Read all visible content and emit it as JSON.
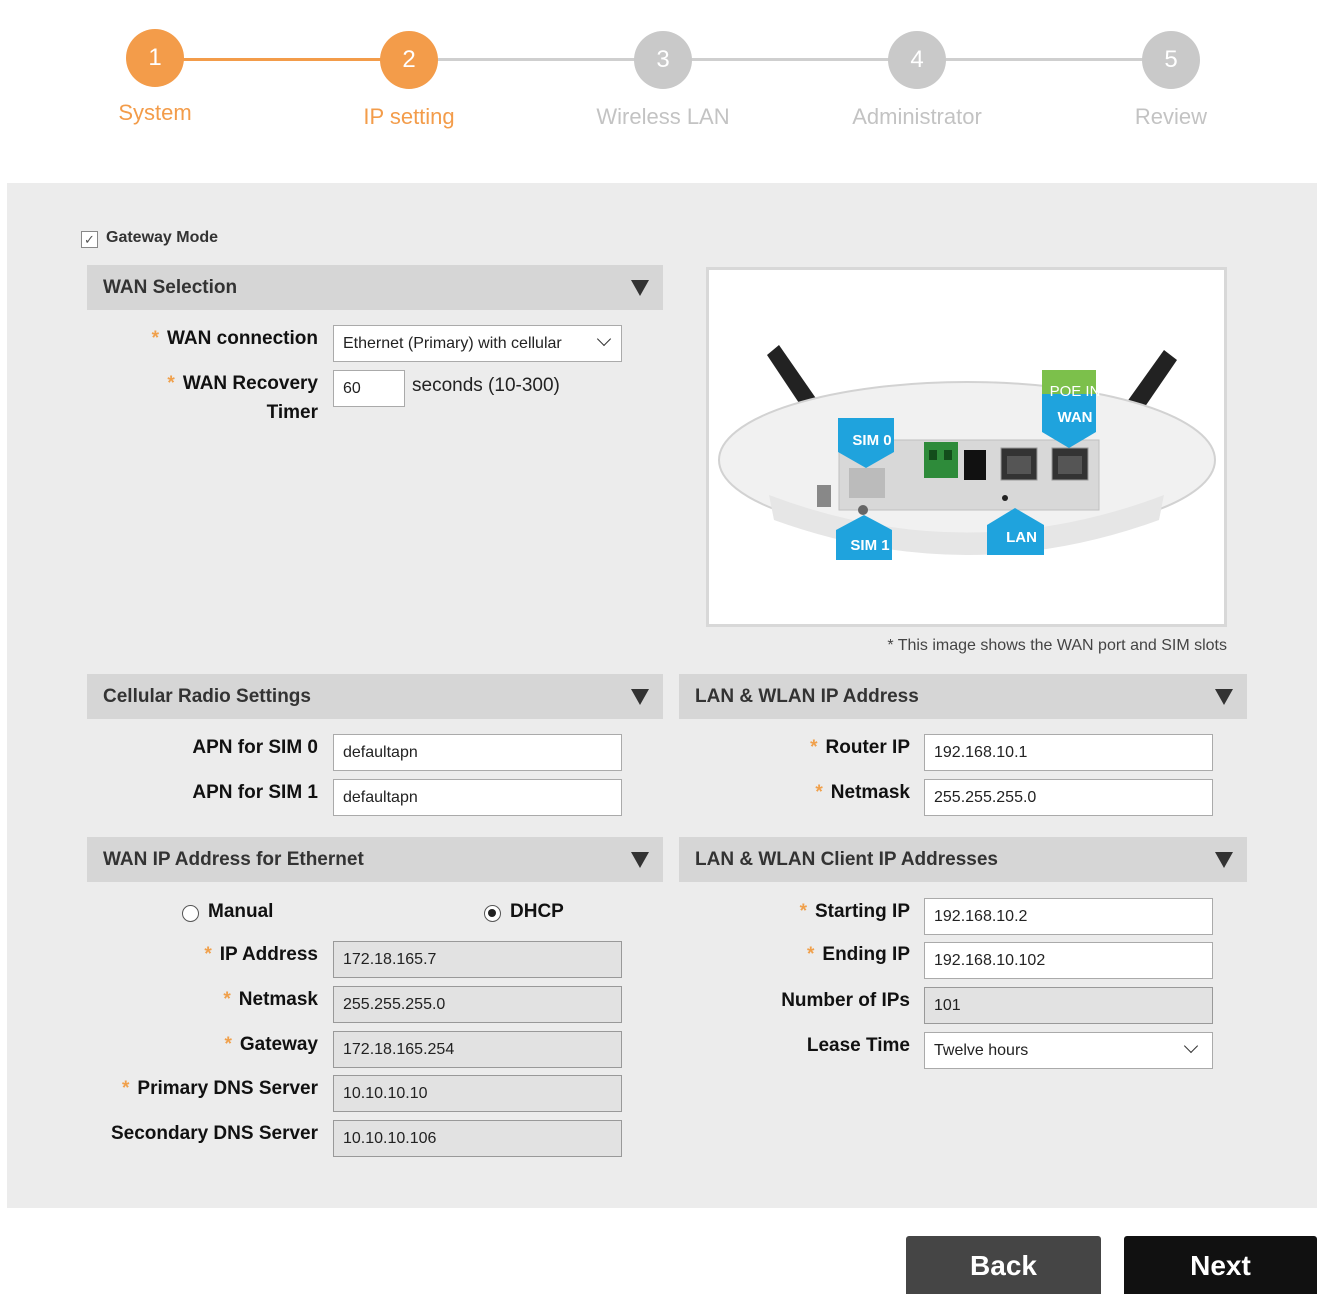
{
  "colors": {
    "active": "#f39c4a",
    "inactive_circle": "#c9c9c9",
    "inactive_text": "#c3c3c3",
    "active_line": "#f39c4a",
    "inactive_line": "#cfcfcf",
    "back_button": "#454545",
    "next_button": "#111111"
  },
  "stepper": {
    "steps": [
      {
        "number": "1",
        "label": "System",
        "state": "done"
      },
      {
        "number": "2",
        "label": "IP setting",
        "state": "current"
      },
      {
        "number": "3",
        "label": "Wireless LAN",
        "state": "todo"
      },
      {
        "number": "4",
        "label": "Administrator",
        "state": "todo"
      },
      {
        "number": "5",
        "label": "Review",
        "state": "todo"
      }
    ]
  },
  "gateway_mode": {
    "label": "Gateway Mode",
    "checked": true,
    "check_glyph": "✓"
  },
  "required_mark": "*",
  "wan_selection": {
    "title": "WAN Selection",
    "wan_connection_label": "WAN connection",
    "wan_connection_value": "Ethernet (Primary) with cellular",
    "wan_recovery_label_1": "WAN Recovery",
    "wan_recovery_label_2": "Timer",
    "wan_recovery_value": "60",
    "wan_recovery_hint": "seconds (10-300)"
  },
  "device_image": {
    "labels": {
      "poe_in": "POE IN",
      "wan": "WAN",
      "sim0": "SIM 0",
      "sim1": "SIM 1",
      "lan": "LAN"
    },
    "caption": "* This image shows the WAN port and SIM slots"
  },
  "cellular": {
    "title": "Cellular Radio Settings",
    "apn0_label": "APN for SIM 0",
    "apn0_value": "defaultapn",
    "apn1_label": "APN for SIM 1",
    "apn1_value": "defaultapn"
  },
  "lan_ip": {
    "title": "LAN & WLAN IP Address",
    "router_ip_label": "Router IP",
    "router_ip_value": "192.168.10.1",
    "netmask_label": "Netmask",
    "netmask_value": "255.255.255.0"
  },
  "wan_ip": {
    "title": "WAN IP Address for Ethernet",
    "manual_label": "Manual",
    "dhcp_label": "DHCP",
    "selected": "DHCP",
    "ip_label": "IP Address",
    "ip_value": "172.18.165.7",
    "netmask_label": "Netmask",
    "netmask_value": "255.255.255.0",
    "gateway_label": "Gateway",
    "gateway_value": "172.18.165.254",
    "dns1_label": "Primary DNS Server",
    "dns1_value": "10.10.10.10",
    "dns2_label": "Secondary DNS Server",
    "dns2_value": "10.10.10.106"
  },
  "lan_client": {
    "title": "LAN & WLAN Client IP Addresses",
    "start_label": "Starting IP",
    "start_value": "192.168.10.2",
    "end_label": "Ending IP",
    "end_value": "192.168.10.102",
    "count_label": "Number of IPs",
    "count_value": "101",
    "lease_label": "Lease Time",
    "lease_value": "Twelve hours"
  },
  "footer": {
    "back_label": "Back",
    "next_label": "Next"
  }
}
